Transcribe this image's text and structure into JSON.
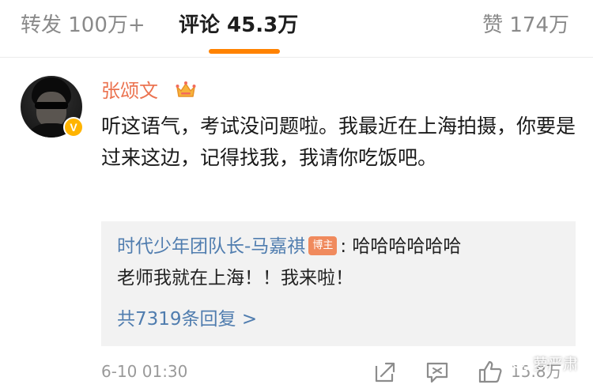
{
  "tabs": {
    "repost": "转发 100万+",
    "comment": "评论 45.3万",
    "like": "赞 174万"
  },
  "comment": {
    "username": "张颂文",
    "text": "听这语气，考试没问题啦。我最近在上海拍摄，你要是过来这边，记得找我，我请你吃饭吧。",
    "timestamp": "6-10 01:30",
    "like_count": "15.8万"
  },
  "reply": {
    "author": "时代少年团队长-马嘉祺",
    "badge": "博主",
    "colon": ":",
    "text_line1": "哈哈哈哈哈哈",
    "text_line2": "老师我就在上海！！我来啦！",
    "count_text": "共7319条回复 >"
  },
  "watermark": {
    "text": "萝严肃"
  },
  "colors": {
    "accent_orange": "#ff8200",
    "username": "#eb7350",
    "link_blue": "#507daf",
    "reply_bg": "#f2f2f2"
  },
  "icons": {
    "verified": "verified-v-badge",
    "crown": "crown-icon",
    "share": "share-icon",
    "comment": "comment-icon",
    "like": "thumbs-up-icon"
  }
}
